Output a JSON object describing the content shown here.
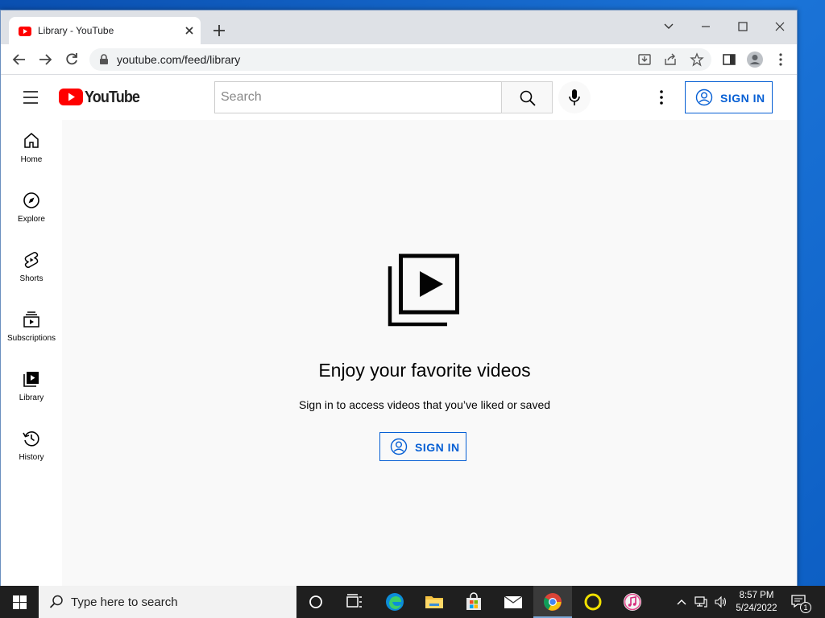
{
  "browser": {
    "tab_title": "Library - YouTube",
    "url": "youtube.com/feed/library"
  },
  "youtube": {
    "logo_text": "YouTube",
    "search_placeholder": "Search",
    "header_signin_label": "SIGN IN",
    "sidebar": [
      {
        "label": "Home",
        "icon": "home-icon"
      },
      {
        "label": "Explore",
        "icon": "compass-icon"
      },
      {
        "label": "Shorts",
        "icon": "shorts-icon"
      },
      {
        "label": "Subscriptions",
        "icon": "subscriptions-icon"
      },
      {
        "label": "Library",
        "icon": "library-icon"
      },
      {
        "label": "History",
        "icon": "history-icon"
      }
    ],
    "main": {
      "headline": "Enjoy your favorite videos",
      "subline": "Sign in to access videos that you’ve liked or saved",
      "signin_label": "SIGN IN"
    }
  },
  "taskbar": {
    "search_placeholder": "Type here to search",
    "apps": [
      "task-view-icon",
      "edge-icon",
      "file-explorer-icon",
      "store-icon",
      "mail-icon",
      "chrome-icon",
      "cortana-ring-icon",
      "itunes-icon"
    ],
    "time": "8:57 PM",
    "date": "5/24/2022",
    "notification_count": "1"
  },
  "colors": {
    "youtube_red": "#ff0000",
    "link_blue": "#065fd4",
    "page_bg": "#f9f9f9",
    "taskbar_bg": "#1f1f1f"
  }
}
